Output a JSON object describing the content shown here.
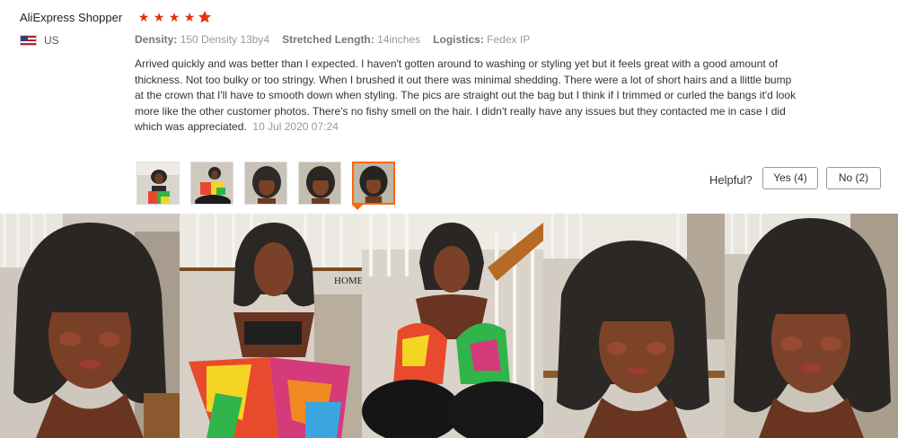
{
  "reviewer": {
    "name": "AliExpress Shopper",
    "country": "US",
    "rating_stars": 4.5
  },
  "attributes": [
    {
      "label": "Density:",
      "value": "150 Density 13by4"
    },
    {
      "label": "Stretched Length:",
      "value": "14inches"
    },
    {
      "label": "Logistics:",
      "value": "Fedex IP"
    }
  ],
  "review": {
    "text": "Arrived quickly and was better than I expected. I haven't gotten around to washing or styling yet but it feels great with a good amount of thickness. Not too bulky or too stringy. When I brushed it out there was minimal shedding. There were a lot of short hairs and a llittle bump at the crown that I'll have to smooth down when styling. The pics are straight out the bag but I think if I trimmed or curled the bangs it'd look more like the other customer photos. There's no fishy smell on the hair. I didn't really have any issues but they contacted me in case I did which was appreciated.",
    "date": "10 Jul 2020 07:24"
  },
  "helpful": {
    "label": "Helpful?",
    "yes_label": "Yes (4)",
    "no_label": "No (2)"
  },
  "thumbnails": {
    "count": 5,
    "selected_index": 4
  },
  "colors": {
    "star": "#e62e04",
    "selected_border": "#ff6600",
    "attr_label": "#777777",
    "muted_text": "#999999"
  },
  "icons": {
    "flag": "us-flag-icon",
    "star": "star-icon"
  },
  "gallery": {
    "photo_sign_text": "HOME"
  }
}
